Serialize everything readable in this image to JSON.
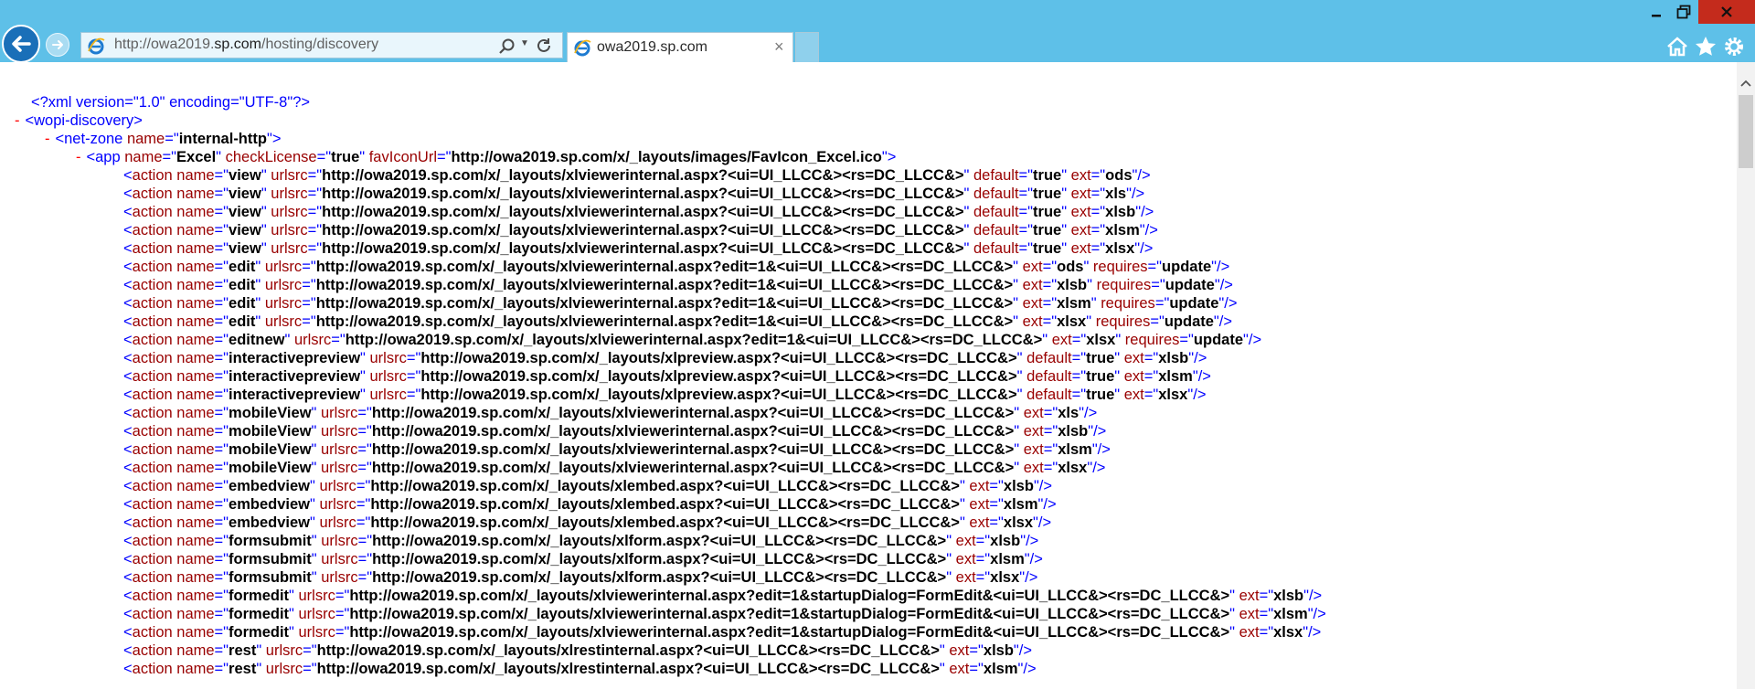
{
  "browser": {
    "address_plain_prefix": "http://owa2019.",
    "address_domain": "sp.com",
    "address_path": "/hosting/discovery",
    "tab_title": "owa2019.sp.com",
    "tab_close": "×"
  },
  "colors": {
    "chrome": "#5ec0e8",
    "tag_blue": "#0000ff",
    "attr_red": "#990000",
    "minus_red": "#ff0000",
    "close_red": "#c42b1c"
  },
  "icons": [
    "back-arrow-icon",
    "forward-arrow-icon",
    "ie-logo-icon",
    "search-icon",
    "dropdown-icon",
    "refresh-icon",
    "tab-close-icon",
    "minimize-icon",
    "restore-icon",
    "window-close-icon",
    "home-icon",
    "favorites-star-icon",
    "settings-gear-icon",
    "scroll-up-icon"
  ],
  "xml": {
    "decl": "<?xml version=\"1.0\" encoding=\"UTF-8\"?>",
    "root_open": "<wopi-discovery>",
    "zone_open_pre": "<net-zone ",
    "zone_attr": "name",
    "zone_val": "internal-http",
    "zone_close": ">",
    "app_tag": "<app ",
    "app_attrs": [
      {
        "n": "name",
        "v": "Excel"
      },
      {
        "n": "checkLicense",
        "v": "true"
      },
      {
        "n": "favIconUrl",
        "v": "http://owa2019.sp.com/x/_layouts/images/FavIcon_Excel.ico"
      }
    ],
    "app_close": ">",
    "actions": [
      {
        "name": "view",
        "urlsrc": "http://owa2019.sp.com/x/_layouts/xlviewerinternal.aspx?<ui=UI_LLCC&><rs=DC_LLCC&>",
        "attrs": [
          [
            "default",
            "true"
          ],
          [
            "ext",
            "ods"
          ]
        ]
      },
      {
        "name": "view",
        "urlsrc": "http://owa2019.sp.com/x/_layouts/xlviewerinternal.aspx?<ui=UI_LLCC&><rs=DC_LLCC&>",
        "attrs": [
          [
            "default",
            "true"
          ],
          [
            "ext",
            "xls"
          ]
        ]
      },
      {
        "name": "view",
        "urlsrc": "http://owa2019.sp.com/x/_layouts/xlviewerinternal.aspx?<ui=UI_LLCC&><rs=DC_LLCC&>",
        "attrs": [
          [
            "default",
            "true"
          ],
          [
            "ext",
            "xlsb"
          ]
        ]
      },
      {
        "name": "view",
        "urlsrc": "http://owa2019.sp.com/x/_layouts/xlviewerinternal.aspx?<ui=UI_LLCC&><rs=DC_LLCC&>",
        "attrs": [
          [
            "default",
            "true"
          ],
          [
            "ext",
            "xlsm"
          ]
        ]
      },
      {
        "name": "view",
        "urlsrc": "http://owa2019.sp.com/x/_layouts/xlviewerinternal.aspx?<ui=UI_LLCC&><rs=DC_LLCC&>",
        "attrs": [
          [
            "default",
            "true"
          ],
          [
            "ext",
            "xlsx"
          ]
        ]
      },
      {
        "name": "edit",
        "urlsrc": "http://owa2019.sp.com/x/_layouts/xlviewerinternal.aspx?edit=1&<ui=UI_LLCC&><rs=DC_LLCC&>",
        "attrs": [
          [
            "ext",
            "ods"
          ],
          [
            "requires",
            "update"
          ]
        ]
      },
      {
        "name": "edit",
        "urlsrc": "http://owa2019.sp.com/x/_layouts/xlviewerinternal.aspx?edit=1&<ui=UI_LLCC&><rs=DC_LLCC&>",
        "attrs": [
          [
            "ext",
            "xlsb"
          ],
          [
            "requires",
            "update"
          ]
        ]
      },
      {
        "name": "edit",
        "urlsrc": "http://owa2019.sp.com/x/_layouts/xlviewerinternal.aspx?edit=1&<ui=UI_LLCC&><rs=DC_LLCC&>",
        "attrs": [
          [
            "ext",
            "xlsm"
          ],
          [
            "requires",
            "update"
          ]
        ]
      },
      {
        "name": "edit",
        "urlsrc": "http://owa2019.sp.com/x/_layouts/xlviewerinternal.aspx?edit=1&<ui=UI_LLCC&><rs=DC_LLCC&>",
        "attrs": [
          [
            "ext",
            "xlsx"
          ],
          [
            "requires",
            "update"
          ]
        ]
      },
      {
        "name": "editnew",
        "urlsrc": "http://owa2019.sp.com/x/_layouts/xlviewerinternal.aspx?edit=1&<ui=UI_LLCC&><rs=DC_LLCC&>",
        "attrs": [
          [
            "ext",
            "xlsx"
          ],
          [
            "requires",
            "update"
          ]
        ]
      },
      {
        "name": "interactivepreview",
        "urlsrc": "http://owa2019.sp.com/x/_layouts/xlpreview.aspx?<ui=UI_LLCC&><rs=DC_LLCC&>",
        "attrs": [
          [
            "default",
            "true"
          ],
          [
            "ext",
            "xlsb"
          ]
        ]
      },
      {
        "name": "interactivepreview",
        "urlsrc": "http://owa2019.sp.com/x/_layouts/xlpreview.aspx?<ui=UI_LLCC&><rs=DC_LLCC&>",
        "attrs": [
          [
            "default",
            "true"
          ],
          [
            "ext",
            "xlsm"
          ]
        ]
      },
      {
        "name": "interactivepreview",
        "urlsrc": "http://owa2019.sp.com/x/_layouts/xlpreview.aspx?<ui=UI_LLCC&><rs=DC_LLCC&>",
        "attrs": [
          [
            "default",
            "true"
          ],
          [
            "ext",
            "xlsx"
          ]
        ]
      },
      {
        "name": "mobileView",
        "urlsrc": "http://owa2019.sp.com/x/_layouts/xlviewerinternal.aspx?<ui=UI_LLCC&><rs=DC_LLCC&>",
        "attrs": [
          [
            "ext",
            "xls"
          ]
        ]
      },
      {
        "name": "mobileView",
        "urlsrc": "http://owa2019.sp.com/x/_layouts/xlviewerinternal.aspx?<ui=UI_LLCC&><rs=DC_LLCC&>",
        "attrs": [
          [
            "ext",
            "xlsb"
          ]
        ]
      },
      {
        "name": "mobileView",
        "urlsrc": "http://owa2019.sp.com/x/_layouts/xlviewerinternal.aspx?<ui=UI_LLCC&><rs=DC_LLCC&>",
        "attrs": [
          [
            "ext",
            "xlsm"
          ]
        ]
      },
      {
        "name": "mobileView",
        "urlsrc": "http://owa2019.sp.com/x/_layouts/xlviewerinternal.aspx?<ui=UI_LLCC&><rs=DC_LLCC&>",
        "attrs": [
          [
            "ext",
            "xlsx"
          ]
        ]
      },
      {
        "name": "embedview",
        "urlsrc": "http://owa2019.sp.com/x/_layouts/xlembed.aspx?<ui=UI_LLCC&><rs=DC_LLCC&>",
        "attrs": [
          [
            "ext",
            "xlsb"
          ]
        ]
      },
      {
        "name": "embedview",
        "urlsrc": "http://owa2019.sp.com/x/_layouts/xlembed.aspx?<ui=UI_LLCC&><rs=DC_LLCC&>",
        "attrs": [
          [
            "ext",
            "xlsm"
          ]
        ]
      },
      {
        "name": "embedview",
        "urlsrc": "http://owa2019.sp.com/x/_layouts/xlembed.aspx?<ui=UI_LLCC&><rs=DC_LLCC&>",
        "attrs": [
          [
            "ext",
            "xlsx"
          ]
        ]
      },
      {
        "name": "formsubmit",
        "urlsrc": "http://owa2019.sp.com/x/_layouts/xlform.aspx?<ui=UI_LLCC&><rs=DC_LLCC&>",
        "attrs": [
          [
            "ext",
            "xlsb"
          ]
        ]
      },
      {
        "name": "formsubmit",
        "urlsrc": "http://owa2019.sp.com/x/_layouts/xlform.aspx?<ui=UI_LLCC&><rs=DC_LLCC&>",
        "attrs": [
          [
            "ext",
            "xlsm"
          ]
        ]
      },
      {
        "name": "formsubmit",
        "urlsrc": "http://owa2019.sp.com/x/_layouts/xlform.aspx?<ui=UI_LLCC&><rs=DC_LLCC&>",
        "attrs": [
          [
            "ext",
            "xlsx"
          ]
        ]
      },
      {
        "name": "formedit",
        "urlsrc": "http://owa2019.sp.com/x/_layouts/xlviewerinternal.aspx?edit=1&startupDialog=FormEdit&<ui=UI_LLCC&><rs=DC_LLCC&>",
        "attrs": [
          [
            "ext",
            "xlsb"
          ]
        ]
      },
      {
        "name": "formedit",
        "urlsrc": "http://owa2019.sp.com/x/_layouts/xlviewerinternal.aspx?edit=1&startupDialog=FormEdit&<ui=UI_LLCC&><rs=DC_LLCC&>",
        "attrs": [
          [
            "ext",
            "xlsm"
          ]
        ]
      },
      {
        "name": "formedit",
        "urlsrc": "http://owa2019.sp.com/x/_layouts/xlviewerinternal.aspx?edit=1&startupDialog=FormEdit&<ui=UI_LLCC&><rs=DC_LLCC&>",
        "attrs": [
          [
            "ext",
            "xlsx"
          ]
        ]
      },
      {
        "name": "rest",
        "urlsrc": "http://owa2019.sp.com/x/_layouts/xlrestinternal.aspx?<ui=UI_LLCC&><rs=DC_LLCC&>",
        "attrs": [
          [
            "ext",
            "xlsb"
          ]
        ]
      },
      {
        "name": "rest",
        "urlsrc": "http://owa2019.sp.com/x/_layouts/xlrestinternal.aspx?<ui=UI_LLCC&><rs=DC_LLCC&>",
        "attrs": [
          [
            "ext",
            "xlsm"
          ]
        ]
      }
    ]
  }
}
